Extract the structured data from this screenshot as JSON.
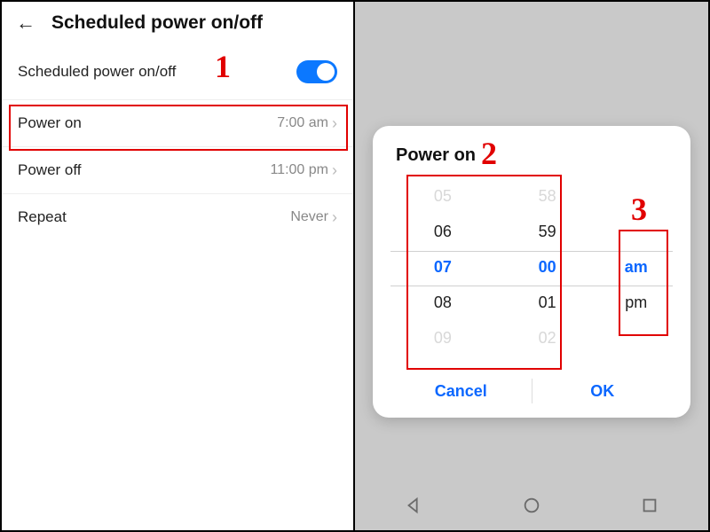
{
  "left": {
    "title": "Scheduled power on/off",
    "rows": {
      "toggle_label": "Scheduled power on/off",
      "power_on_label": "Power on",
      "power_on_value": "7:00 am",
      "power_off_label": "Power off",
      "power_off_value": "11:00 pm",
      "repeat_label": "Repeat",
      "repeat_value": "Never"
    }
  },
  "dialog": {
    "title": "Power on",
    "hours": [
      "05",
      "06",
      "07",
      "08",
      "09"
    ],
    "minutes": [
      "58",
      "59",
      "00",
      "01",
      "02"
    ],
    "ampm": [
      "am",
      "pm"
    ],
    "cancel": "Cancel",
    "ok": "OK"
  },
  "callouts": {
    "one": "1",
    "two": "2",
    "three": "3"
  }
}
